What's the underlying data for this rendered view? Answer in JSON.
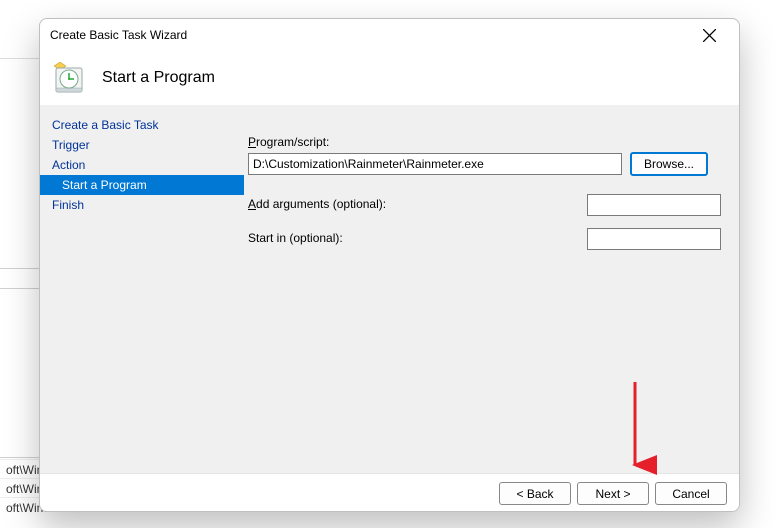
{
  "bgRows": {
    "r1": "oft\\Windo",
    "r2": "oft\\Windows\\U...",
    "r3": "oft\\Windows\\Fli..."
  },
  "dialog": {
    "title": "Create Basic Task Wizard",
    "header": "Start a Program"
  },
  "sidebar": {
    "items": [
      {
        "label": "Create a Basic Task"
      },
      {
        "label": "Trigger"
      },
      {
        "label": "Action"
      },
      {
        "label": "Start a Program"
      },
      {
        "label": "Finish"
      }
    ]
  },
  "form": {
    "programLabelPrefix": "P",
    "programLabelRest": "rogram/script:",
    "programValue": "D:\\Customization\\Rainmeter\\Rainmeter.exe",
    "browse": "Browse...",
    "argsLabelPrefix": "A",
    "argsLabelRest": "dd arguments (optional):",
    "argsValue": "",
    "startInLabel": "Start in (optional):",
    "startInValue": ""
  },
  "footer": {
    "back": "< Back",
    "next": "Next >",
    "cancel": "Cancel"
  }
}
